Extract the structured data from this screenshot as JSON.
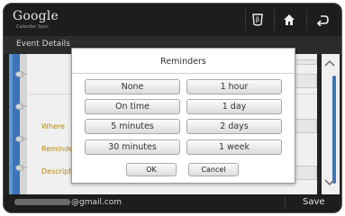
{
  "topbar": {
    "logo": "Google",
    "logo_sub": "Calendar Sync",
    "icons": [
      "beta-icon",
      "home-icon",
      "back-icon"
    ]
  },
  "header": {
    "title": "Event Details"
  },
  "form": {
    "where_label": "Where",
    "reminders_label": "Reminde",
    "description_label": "Descript"
  },
  "dialog": {
    "title": "Reminders",
    "options": [
      "None",
      "1 hour",
      "On time",
      "1 day",
      "5 minutes",
      "2 days",
      "30 minutes",
      "1 week"
    ],
    "ok_label": "OK",
    "cancel_label": "Cancel"
  },
  "bottombar": {
    "account_suffix": "@gmail.com",
    "save_label": "Save"
  },
  "colors": {
    "accent": "#3c74b8",
    "label": "#b8860b"
  }
}
